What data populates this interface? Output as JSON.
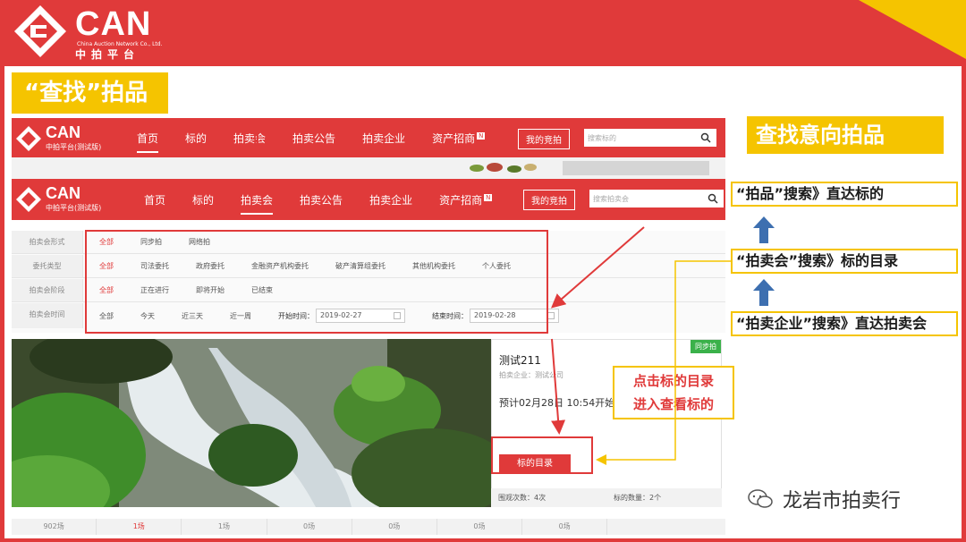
{
  "logo": {
    "name": "CAN",
    "english": "China Auction Network Co., Ltd.",
    "chinese": "中拍平台"
  },
  "slide": {
    "title": "“查找”拍品",
    "find_tag": "查找意向拍品",
    "notes": [
      "“拍品”搜索》直达标的",
      "“拍卖会”搜索》标的目录",
      "“拍卖企业”搜索》直达拍卖会"
    ],
    "callout_line1": "点击标的目录",
    "callout_line2": "进入查看标的",
    "watermark": "龙岩市拍卖行"
  },
  "site": {
    "mini_logo": "CAN",
    "mini_sub": "中拍平台(测试版)",
    "menu": [
      "首页",
      "标的",
      "拍卖会",
      "拍卖公告",
      "拍卖企业",
      "资产招商"
    ],
    "menu_badge": "N",
    "my_bid": "我的竞拍",
    "search_placeholder_1": "搜索标的",
    "search_placeholder_2": "搜索拍卖会"
  },
  "filters": {
    "rows": [
      {
        "label": "拍卖会形式",
        "options": [
          "全部",
          "同步拍",
          "网络拍"
        ],
        "selected": 0
      },
      {
        "label": "委托类型",
        "options": [
          "全部",
          "司法委托",
          "政府委托",
          "金融资产机构委托",
          "破产清算组委托",
          "其他机构委托",
          "个人委托"
        ],
        "selected": 0
      },
      {
        "label": "拍卖会阶段",
        "options": [
          "全部",
          "正在进行",
          "即将开始",
          "已结束"
        ],
        "selected": 0
      },
      {
        "label": "拍卖会时间",
        "options": [
          "全部",
          "今天",
          "近三天",
          "近一周"
        ],
        "selected": -1
      }
    ],
    "start_label": "开始时间：",
    "start_value": "2019-02-27",
    "end_label": "结束时间：",
    "end_value": "2019-02-28"
  },
  "auction": {
    "tag": "同步拍",
    "title": "测试211",
    "enterprise": "拍卖企业：测试公司",
    "time": "预计02月28日  10:54开始",
    "catalog_button": "标的目录",
    "views": "围观次数：4次",
    "lots": "标的数量：2个"
  },
  "bottom_tabs": [
    "902场",
    "1场",
    "1场",
    "0场",
    "0场",
    "0场",
    "0场",
    ""
  ],
  "colors": {
    "brand_red": "#e03a3a",
    "highlight_yellow": "#f5c400",
    "sync_green": "#3ab14a"
  }
}
